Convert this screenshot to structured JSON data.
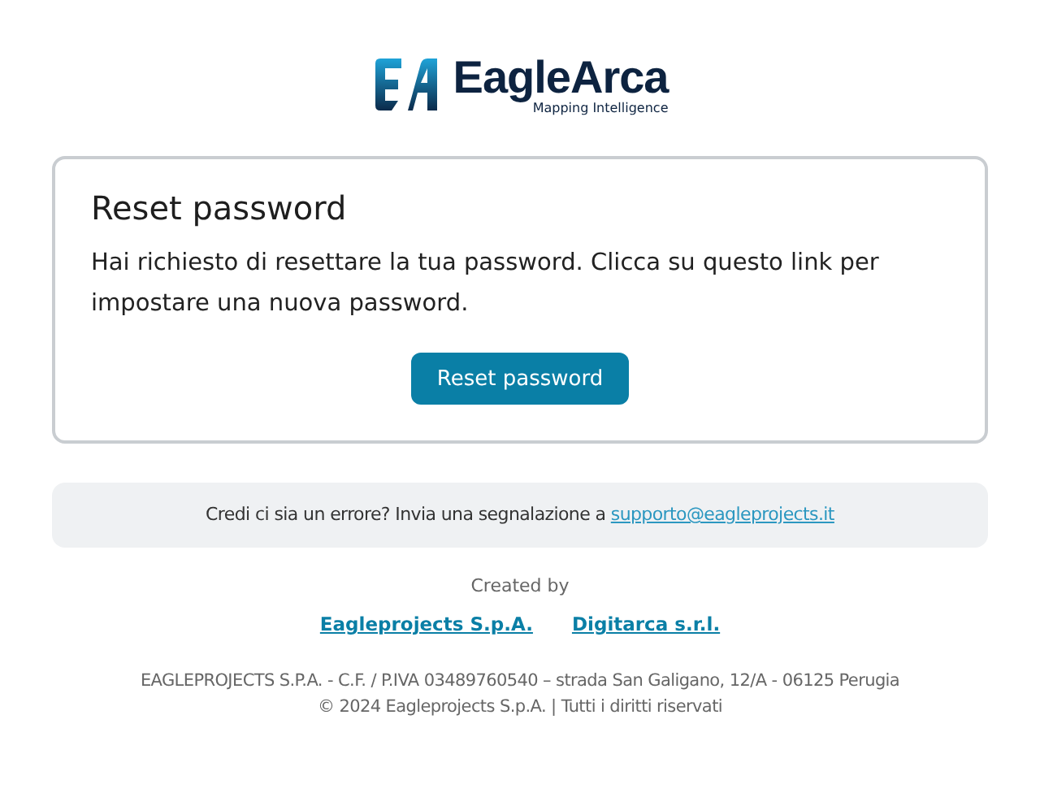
{
  "logo": {
    "name": "EagleArca",
    "tagline": "Mapping Intelligence"
  },
  "card": {
    "title": "Reset password",
    "message": "Hai richiesto di resettare la tua password. Clicca su questo link per impostare una nuova password.",
    "button": "Reset password"
  },
  "notice": {
    "text": "Credi ci sia un errore? Invia una segnalazione a ",
    "link": "supporto@eagleprojects.it"
  },
  "created_by": {
    "label": "Created by",
    "links": [
      "Eagleprojects S.p.A.",
      "Digitarca s.r.l."
    ]
  },
  "footer": [
    "EAGLEPROJECTS S.P.A. - C.F. / P.IVA 03489760540 – strada San Galigano, 12/A - 06125 Perugia",
    "© 2024 Eagleprojects S.p.A. | Tutti i diritti riservati"
  ]
}
